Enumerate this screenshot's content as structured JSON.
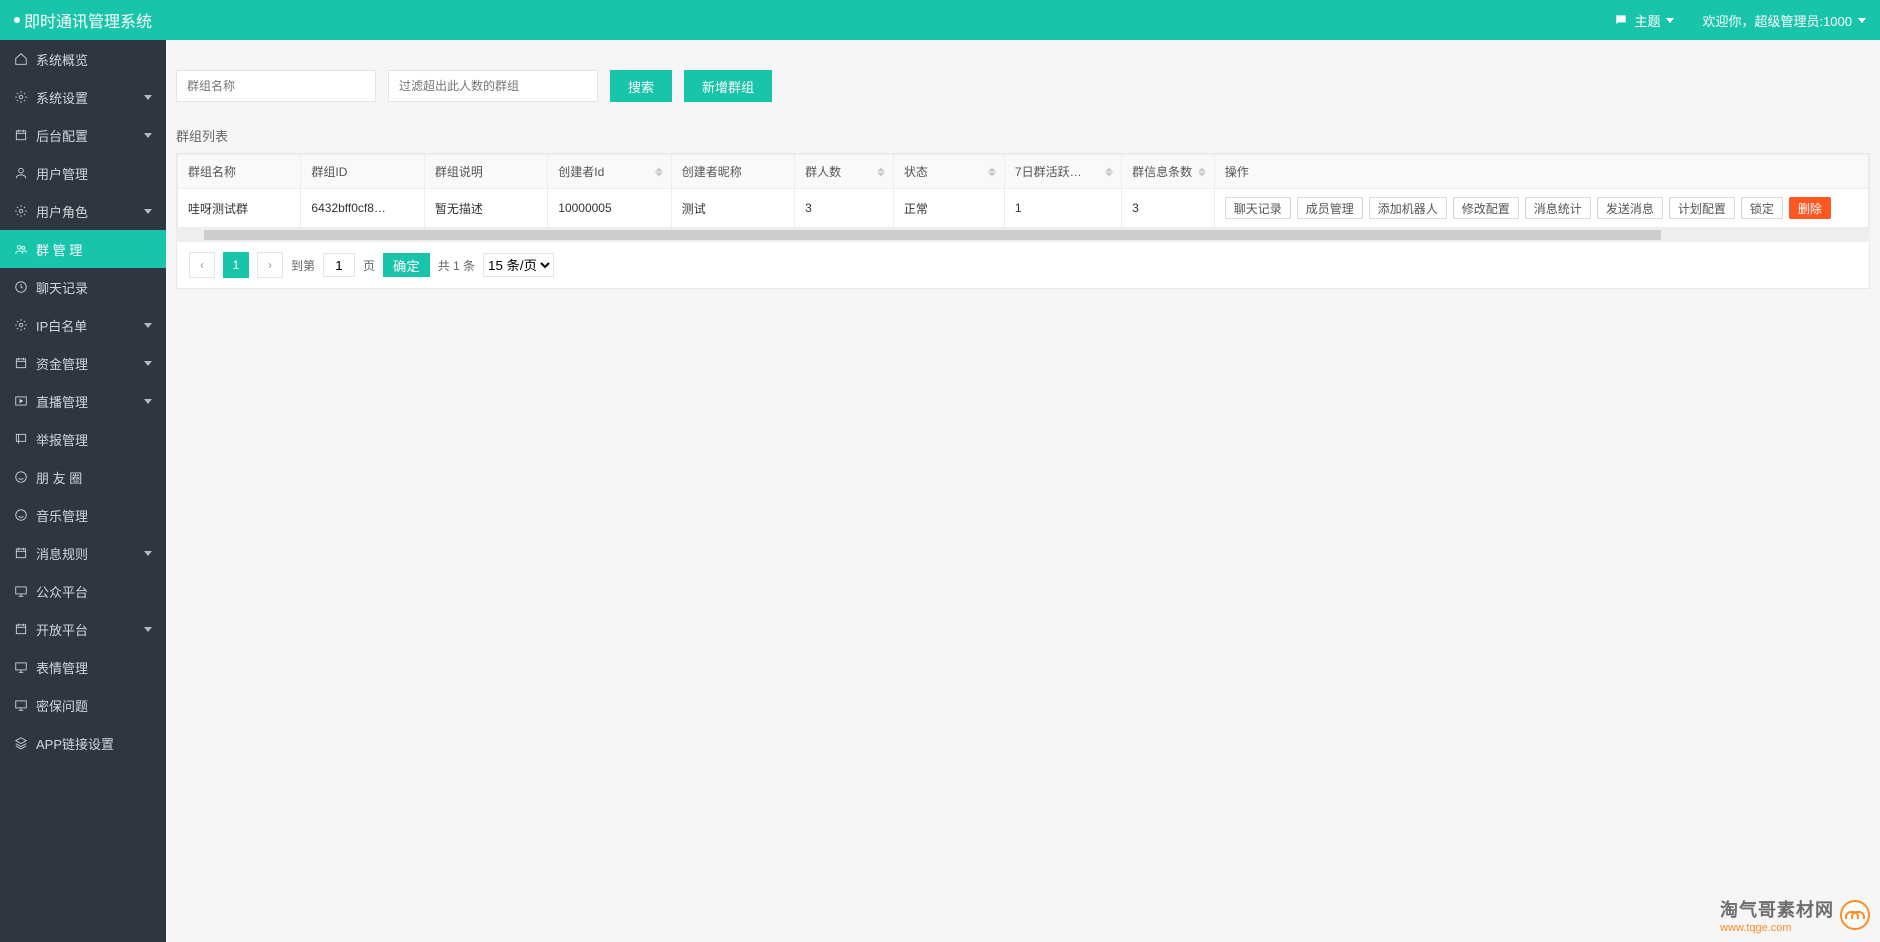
{
  "header": {
    "brand": "即时通讯管理系统",
    "theme_label": "主题",
    "welcome": "欢迎你，超级管理员:1000"
  },
  "sidebar": {
    "items": [
      {
        "label": "系统概览",
        "icon": "home",
        "children": false
      },
      {
        "label": "系统设置",
        "icon": "gear",
        "children": true
      },
      {
        "label": "后台配置",
        "icon": "calendar",
        "children": true
      },
      {
        "label": "用户管理",
        "icon": "user",
        "children": false
      },
      {
        "label": "用户角色",
        "icon": "gear",
        "children": true
      },
      {
        "label": "群 管 理",
        "icon": "group",
        "children": false,
        "active": true
      },
      {
        "label": "聊天记录",
        "icon": "clock",
        "children": false
      },
      {
        "label": "IP白名单",
        "icon": "gear",
        "children": true
      },
      {
        "label": "资金管理",
        "icon": "calendar",
        "children": true
      },
      {
        "label": "直播管理",
        "icon": "play",
        "children": true
      },
      {
        "label": "举报管理",
        "icon": "flag",
        "children": false
      },
      {
        "label": "朋 友 圈",
        "icon": "smile",
        "children": false
      },
      {
        "label": "音乐管理",
        "icon": "smile",
        "children": false
      },
      {
        "label": "消息规则",
        "icon": "calendar",
        "children": true
      },
      {
        "label": "公众平台",
        "icon": "monitor",
        "children": false
      },
      {
        "label": "开放平台",
        "icon": "calendar",
        "children": true
      },
      {
        "label": "表情管理",
        "icon": "monitor",
        "children": false
      },
      {
        "label": "密保问题",
        "icon": "monitor",
        "children": false
      },
      {
        "label": "APP链接设置",
        "icon": "layers",
        "children": false
      }
    ]
  },
  "search": {
    "name_placeholder": "群组名称",
    "filter_placeholder": "过滤超出此人数的群组",
    "search_label": "搜索",
    "add_label": "新增群组"
  },
  "panel_title": "群组列表",
  "table": {
    "headers": [
      "群组名称",
      "群组ID",
      "群组说明",
      "创建者Id",
      "创建者昵称",
      "群人数",
      "状态",
      "7日群活跃…",
      "群信息条数",
      "操作"
    ],
    "rows": [
      {
        "name": "哇呀测试群",
        "gid": "6432bff0cf8…",
        "desc": "暂无描述",
        "creator_id": "10000005",
        "creator_name": "测试",
        "count": "3",
        "status": "正常",
        "active7": "1",
        "msgs": "3"
      }
    ],
    "ops": [
      "聊天记录",
      "成员管理",
      "添加机器人",
      "修改配置",
      "消息统计",
      "发送消息",
      "计划配置",
      "锁定"
    ],
    "op_delete": "删除"
  },
  "pager": {
    "current": "1",
    "jump_label": "到第",
    "page_unit": "页",
    "confirm": "确定",
    "total": "共 1 条",
    "size_option": "15 条/页"
  },
  "watermark": {
    "cn": "淘气哥素材网",
    "url": "www.tqge.com"
  }
}
